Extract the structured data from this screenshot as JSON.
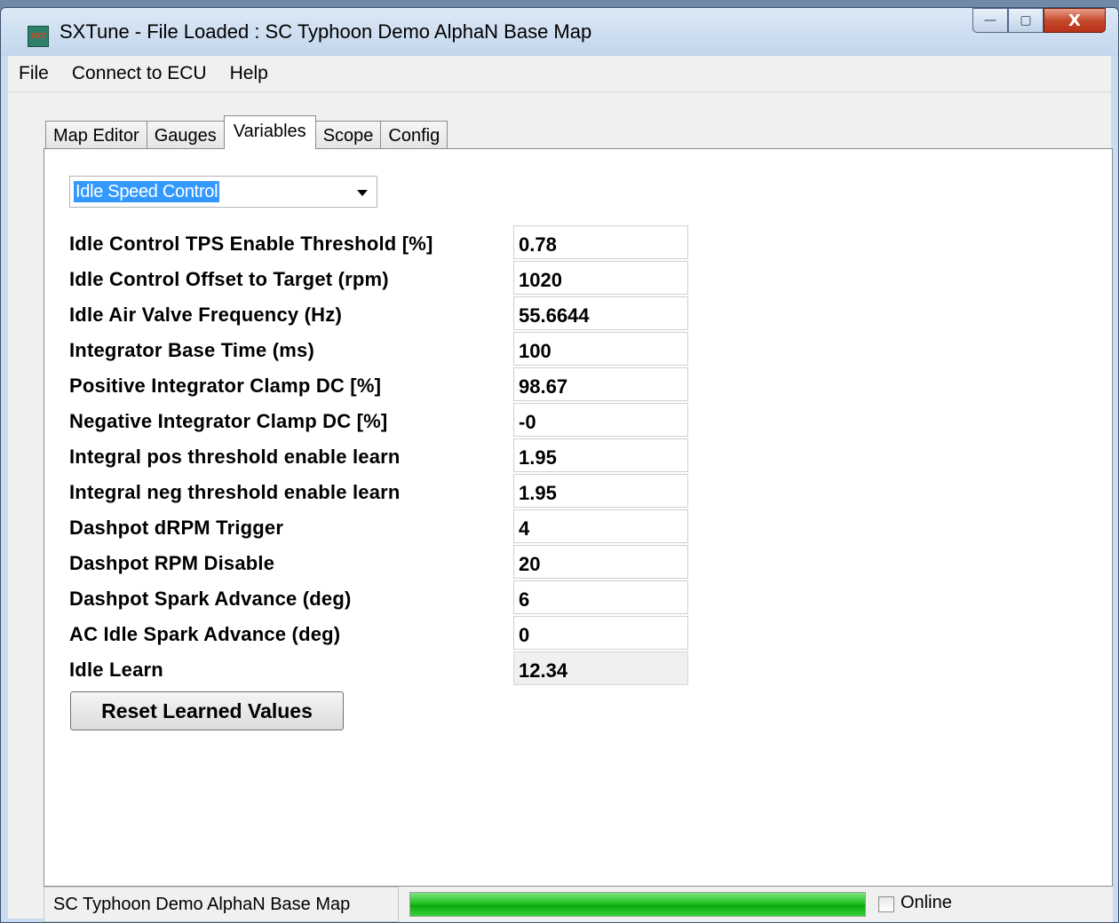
{
  "window": {
    "title": "SXTune - File Loaded :  SC Typhoon Demo AlphaN Base Map",
    "app_icon_text": "SXT",
    "buttons": {
      "minimize": "—",
      "maximize": "▢",
      "close": "X"
    }
  },
  "menu": {
    "items": [
      "File",
      "Connect to ECU",
      "Help"
    ]
  },
  "tabs": {
    "items": [
      "Map Editor",
      "Gauges",
      "Variables",
      "Scope",
      "Config"
    ],
    "active": "Variables"
  },
  "category_select": {
    "value": "Idle Speed Control"
  },
  "variables": [
    {
      "label": "Idle Control TPS Enable Threshold [%]",
      "value": "0.78"
    },
    {
      "label": "Idle Control Offset to Target (rpm)",
      "value": "1020"
    },
    {
      "label": "Idle Air Valve Frequency (Hz)",
      "value": "55.6644"
    },
    {
      "label": "Integrator Base Time (ms)",
      "value": "100"
    },
    {
      "label": "Positive Integrator Clamp DC [%]",
      "value": "98.67"
    },
    {
      "label": "Negative Integrator Clamp DC [%]",
      "value": "-0"
    },
    {
      "label": "Integral pos threshold enable learn",
      "value": "1.95"
    },
    {
      "label": "Integral neg threshold enable learn",
      "value": "1.95"
    },
    {
      "label": "Dashpot dRPM Trigger",
      "value": "4"
    },
    {
      "label": "Dashpot RPM Disable",
      "value": "20"
    },
    {
      "label": "Dashpot Spark Advance (deg)",
      "value": "6"
    },
    {
      "label": "AC Idle Spark Advance (deg)",
      "value": "0"
    },
    {
      "label": "Idle Learn",
      "value": "12.34",
      "readonly": true
    }
  ],
  "reset_button": {
    "label": "Reset Learned Values"
  },
  "status": {
    "file": "SC Typhoon Demo AlphaN Base Map",
    "progress": 1.0,
    "online_label": "Online",
    "online_checked": false
  },
  "colors": {
    "progress": "#1ec21e",
    "selection": "#3399ff"
  }
}
